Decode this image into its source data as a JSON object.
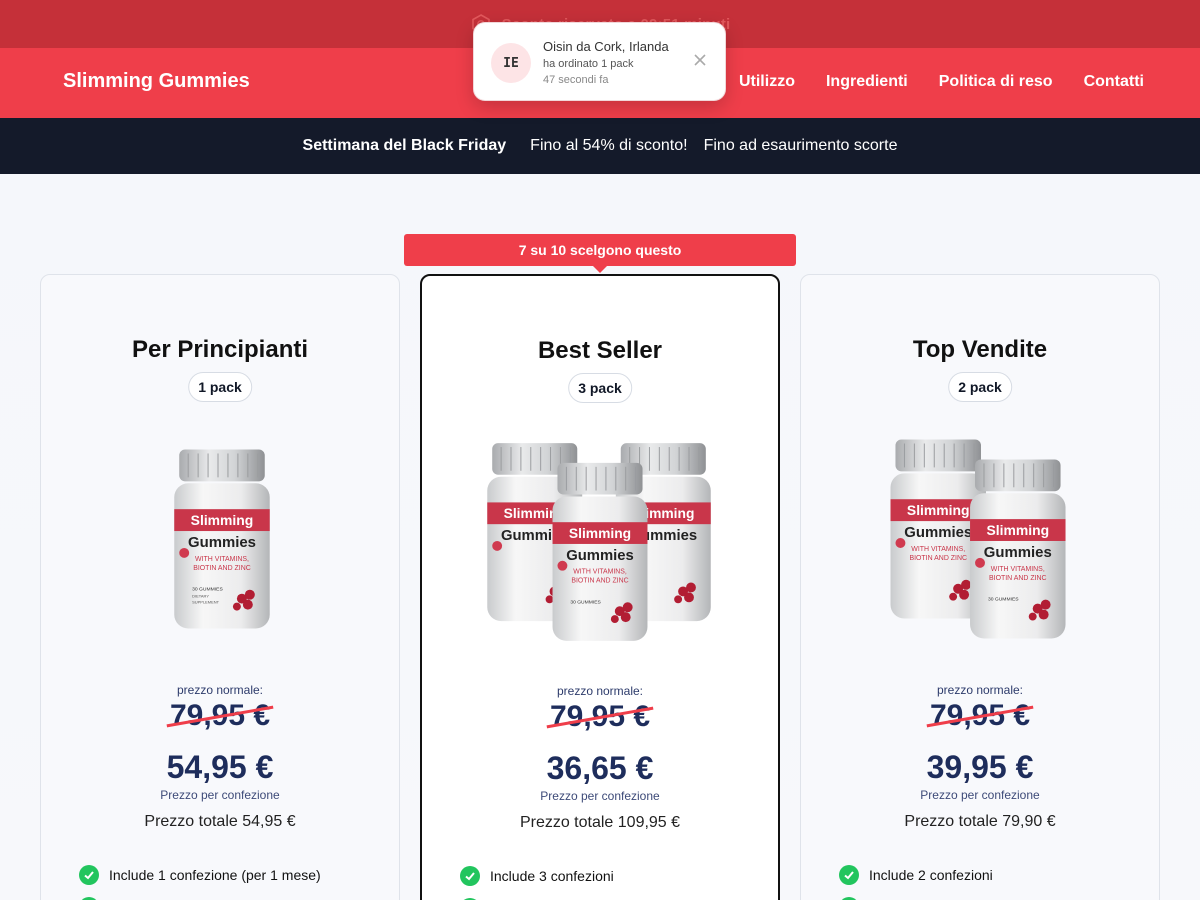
{
  "topbar": {
    "timer_text": "Sconto riservato a 09:51 minuti"
  },
  "navbar": {
    "brand": "Slimming Gummies",
    "links": [
      "Utilizzo",
      "Ingredienti",
      "Politica di reso",
      "Contatti"
    ]
  },
  "promo": {
    "part1": "Settimana del Black Friday",
    "part2": "Fino al 54% di sconto!",
    "part3": "Fino ad esaurimento scorte"
  },
  "toast": {
    "flag": "IE",
    "name": "Oisin da Cork, Irlanda",
    "ordered": "ha ordinato 1 pack",
    "ago": "47 secondi fa"
  },
  "ribbon": "7 su 10 scelgono questo",
  "product_label": {
    "l1": "Slimming",
    "l2": "Gummies",
    "l3": "WITH VITAMINS,",
    "l4": "BIOTIN AND ZINC",
    "l5": "30 GUMMIES",
    "l6": "DIETARY",
    "l7": "SUPPLEMENT"
  },
  "cards": [
    {
      "title": "Per Principianti",
      "pack": "1 pack",
      "normal_label": "prezzo normale:",
      "old_price": "79,95 €",
      "price": "54,95 €",
      "per_pack": "Prezzo per confezione",
      "total": "Prezzo totale 54,95 €",
      "feature": "Include 1 confezione (per 1 mese)"
    },
    {
      "title": "Best Seller",
      "pack": "3 pack",
      "normal_label": "prezzo normale:",
      "old_price": "79,95 €",
      "price": "36,65 €",
      "per_pack": "Prezzo per confezione",
      "total": "Prezzo totale 109,95 €",
      "feature": "Include 3 confezioni"
    },
    {
      "title": "Top Vendite",
      "pack": "2 pack",
      "normal_label": "prezzo normale:",
      "old_price": "79,95 €",
      "price": "39,95 €",
      "per_pack": "Prezzo per confezione",
      "total": "Prezzo totale 79,90 €",
      "feature": "Include 2 confezioni"
    }
  ],
  "colors": {
    "brand_red": "#ef3e4a",
    "dark_bar": "#141a2a",
    "price_navy": "#1e2d5c",
    "check_green": "#22c55e"
  },
  "icons": {
    "timer": "hexagon-clock-icon",
    "close": "close-icon",
    "check": "check-circle-icon"
  }
}
